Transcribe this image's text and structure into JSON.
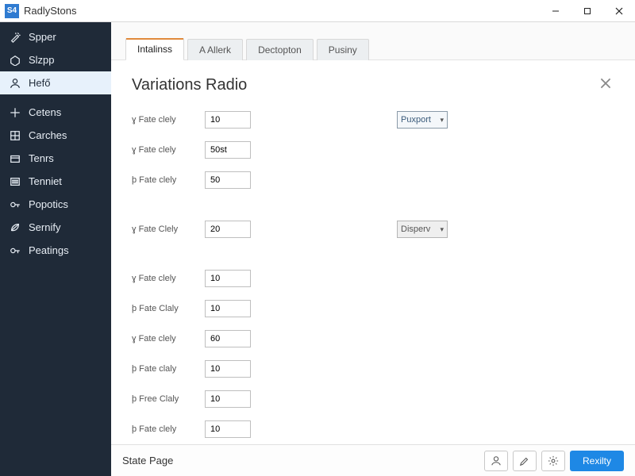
{
  "window": {
    "logo_text": "S4",
    "title": "RadlyStons"
  },
  "sidebar": {
    "items": [
      {
        "label": "Spper",
        "icon": "wand"
      },
      {
        "label": "Slzpp",
        "icon": "tag"
      },
      {
        "label": "Hefő",
        "icon": "user",
        "selected": true
      },
      {
        "label": "Cetens",
        "icon": "plus",
        "gapBefore": true
      },
      {
        "label": "Carches",
        "icon": "grid"
      },
      {
        "label": "Tenrs",
        "icon": "box"
      },
      {
        "label": "Tenniet",
        "icon": "list"
      },
      {
        "label": "Popotics",
        "icon": "key"
      },
      {
        "label": "Sernify",
        "icon": "leaf"
      },
      {
        "label": "Peatings",
        "icon": "key"
      }
    ]
  },
  "tabs": [
    {
      "label": "Intalinss",
      "active": true
    },
    {
      "label": "A Allerk"
    },
    {
      "label": "Dectopton"
    },
    {
      "label": "Pusiny"
    }
  ],
  "page": {
    "title": "Variations Radio"
  },
  "form": {
    "rows": [
      {
        "label": "ɣ Fate clely",
        "value": "10",
        "select": {
          "text": "Puxport",
          "style": "blue"
        }
      },
      {
        "label": "ɣ Fate clely",
        "value": "50st"
      },
      {
        "label": "þ Fate clely",
        "value": "50"
      },
      {
        "gap": true
      },
      {
        "label": "ɣ Fate Clely",
        "value": "20",
        "select": {
          "text": "Disperv",
          "style": "gray"
        }
      },
      {
        "gap": true
      },
      {
        "label": "ɣ Fate clely",
        "value": "10"
      },
      {
        "label": "þ Fate Claly",
        "value": "10"
      },
      {
        "label": "ɣ Fate clely",
        "value": "60"
      },
      {
        "label": "þ Fate claly",
        "value": "10"
      },
      {
        "label": "þ Free Claly",
        "value": "10"
      },
      {
        "label": "þ Fate clely",
        "value": "10"
      }
    ]
  },
  "footer": {
    "label": "State Page",
    "primary": "Rexilty"
  }
}
